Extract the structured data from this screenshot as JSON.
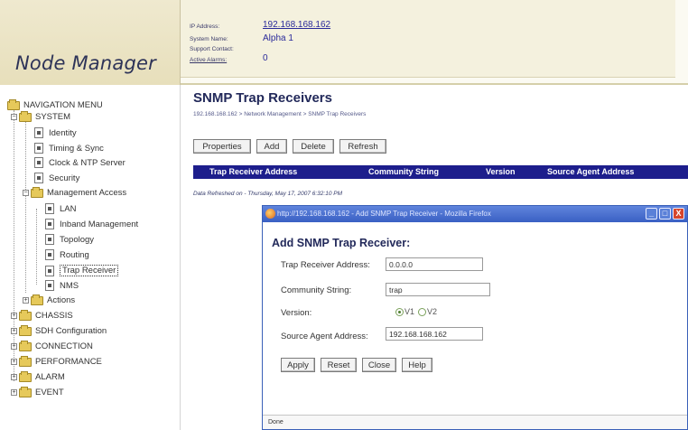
{
  "header": {
    "app_title": "Node Manager",
    "ip_label": "IP Address:",
    "ip_value": "192.168.168.162",
    "system_name_label": "System Name:",
    "system_name_value": "Alpha 1",
    "support_contact_label": "Support Contact:",
    "active_alarms_label": "Active Alarms:",
    "active_alarms_value": "0"
  },
  "sidebar": {
    "items": [
      {
        "label": "NAVIGATION MENU"
      },
      {
        "label": "SYSTEM"
      },
      {
        "label": "Identity"
      },
      {
        "label": "Timing & Sync"
      },
      {
        "label": "Clock & NTP Server"
      },
      {
        "label": "Security"
      },
      {
        "label": "Management Access"
      },
      {
        "label": "LAN"
      },
      {
        "label": "Inband Management"
      },
      {
        "label": "Topology"
      },
      {
        "label": "Routing"
      },
      {
        "label": "Trap Receiver"
      },
      {
        "label": "NMS"
      },
      {
        "label": "Actions"
      },
      {
        "label": "CHASSIS"
      },
      {
        "label": "SDH Configuration"
      },
      {
        "label": "CONNECTION"
      },
      {
        "label": "PERFORMANCE"
      },
      {
        "label": "ALARM"
      },
      {
        "label": "EVENT"
      }
    ]
  },
  "main": {
    "title": "SNMP Trap Receivers",
    "breadcrumb": "192.168.168.162 > Network Management > SNMP Trap Receivers",
    "toolbar": {
      "properties": "Properties",
      "add": "Add",
      "delete": "Delete",
      "refresh": "Refresh"
    },
    "table_columns": [
      "Trap Receiver Address",
      "Community String",
      "Version",
      "Source Agent Address"
    ],
    "data_refreshed": "Data Refreshed on - Thursday, May 17, 2007 6:32:10 PM"
  },
  "dialog": {
    "window_title": "http://192.168.168.162 - Add SNMP Trap Receiver - Mozilla Firefox",
    "heading": "Add SNMP Trap Receiver:",
    "trap_receiver_label": "Trap Receiver Address:",
    "trap_receiver_value": "0.0.0.0",
    "community_label": "Community String:",
    "community_value": "trap",
    "version_label": "Version:",
    "version_v1": "V1",
    "version_v2": "V2",
    "version_selected": "V1",
    "source_agent_label": "Source Agent Address:",
    "source_agent_value": "192.168.168.162",
    "buttons": {
      "apply": "Apply",
      "reset": "Reset",
      "close": "Close",
      "help": "Help"
    },
    "status": "Done"
  },
  "colors": {
    "table_header_bg": "#1d1e8c",
    "title_color": "#22295a",
    "dialog_titlebar": "#3a60c4",
    "header_bg": "#efe9cf"
  }
}
